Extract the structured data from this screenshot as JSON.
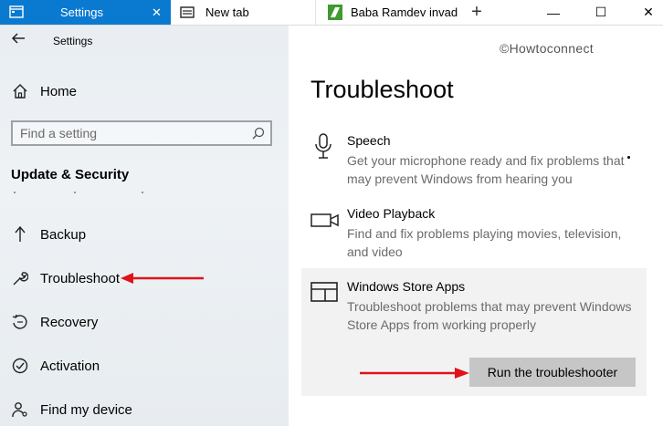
{
  "tabs": [
    {
      "label": "Settings",
      "icon": "settings-app-icon",
      "close": "✕",
      "active": true
    },
    {
      "label": "New tab",
      "icon": "browser-tab-icon"
    },
    {
      "label": "Baba Ramdev invad",
      "icon": "site-favicon"
    }
  ],
  "window_controls": {
    "new_tab": "+",
    "minimize": "—",
    "maximize": "☐",
    "close": "✕"
  },
  "sidebar": {
    "back_icon": "back-arrow-icon",
    "title": "Settings",
    "home_label": "Home",
    "search_placeholder": "Find a setting",
    "section": "Update & Security",
    "items": [
      {
        "label": "Backup",
        "icon": "backup-arrow-icon"
      },
      {
        "label": "Troubleshoot",
        "icon": "wrench-icon"
      },
      {
        "label": "Recovery",
        "icon": "recovery-icon"
      },
      {
        "label": "Activation",
        "icon": "check-circle-icon"
      },
      {
        "label": "Find my device",
        "icon": "person-location-icon"
      }
    ]
  },
  "main": {
    "watermark": "©Howtoconnect",
    "heading": "Troubleshoot",
    "items": [
      {
        "title": "Speech",
        "desc": "Get your microphone ready and fix problems that may prevent Windows from hearing you",
        "icon": "microphone-icon"
      },
      {
        "title": "Video Playback",
        "desc": "Find and fix problems playing movies, television, and video",
        "icon": "video-camera-icon"
      },
      {
        "title": "Windows Store Apps",
        "desc": "Troubleshoot problems that may prevent Windows Store Apps from working properly",
        "icon": "store-apps-icon"
      }
    ],
    "run_button": "Run the troubleshooter"
  },
  "colors": {
    "accent": "#0a7ad1",
    "annotation_arrow": "#e0121b",
    "button_bg": "#c6c6c6"
  }
}
